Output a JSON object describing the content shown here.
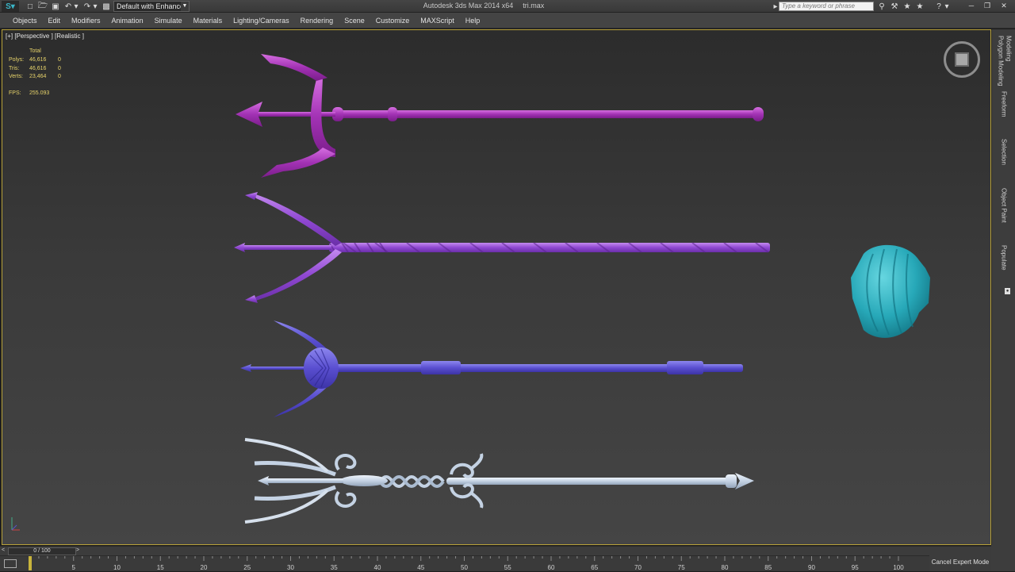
{
  "titlebar": {
    "preset": "Default with Enhance",
    "app_title": "Autodesk 3ds Max  2014 x64",
    "file_name": "tri.max",
    "search_placeholder": "Type a keyword or phrase"
  },
  "menu": [
    "Objects",
    "Edit",
    "Modifiers",
    "Animation",
    "Simulate",
    "Materials",
    "Lighting/Cameras",
    "Rendering",
    "Scene",
    "Customize",
    "MAXScript",
    "Help"
  ],
  "viewport": {
    "label": "[+] [Perspective ] [Realistic ]",
    "stats": {
      "header": "Total",
      "rows": [
        {
          "label": "Polys:",
          "value": "46,616",
          "selected": "0"
        },
        {
          "label": "Tris:",
          "value": "46,616",
          "selected": "0"
        },
        {
          "label": "Verts:",
          "value": "23,464",
          "selected": "0"
        }
      ],
      "fps_label": "FPS:",
      "fps_value": "255.093"
    },
    "objects": [
      {
        "name": "trident-1",
        "color": "#b03cc0"
      },
      {
        "name": "trident-2",
        "color": "#9a4fd6"
      },
      {
        "name": "trident-3",
        "color": "#5a4fd0"
      },
      {
        "name": "trident-4",
        "color": "#c8d6e6"
      },
      {
        "name": "shell",
        "color": "#27a8b8"
      }
    ]
  },
  "ribbon": {
    "tabs": [
      "Modeling",
      "Polygon Modeling",
      "Freeform",
      "Selection",
      "Object Paint",
      "Populate"
    ]
  },
  "timeline": {
    "frame_display": "0 / 100",
    "prev": "<",
    "next": ">",
    "ticks": [
      "5",
      "10",
      "15",
      "20",
      "25",
      "30",
      "35",
      "40",
      "45",
      "50",
      "55",
      "60",
      "65",
      "70",
      "75",
      "80",
      "85",
      "90",
      "95",
      "100"
    ]
  },
  "status": {
    "cancel_expert": "Cancel Expert Mode"
  }
}
